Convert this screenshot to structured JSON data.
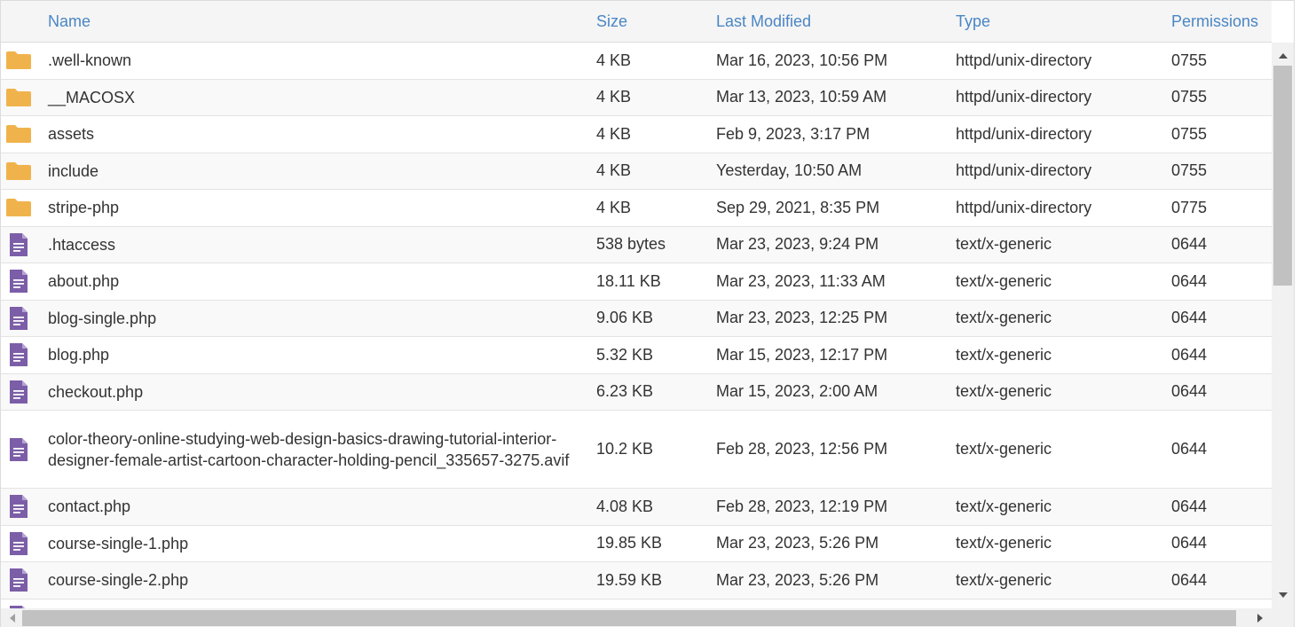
{
  "columns": {
    "name": "Name",
    "size": "Size",
    "modified": "Last Modified",
    "type": "Type",
    "permissions": "Permissions"
  },
  "colors": {
    "folder": "#f0b34c",
    "file": "#7b5ea7",
    "header_text": "#4a86c5"
  },
  "rows": [
    {
      "icon": "folder-icon",
      "name": ".well-known",
      "size": "4 KB",
      "modified": "Mar 16, 2023, 10:56 PM",
      "type": "httpd/unix-directory",
      "perm": "0755"
    },
    {
      "icon": "folder-icon",
      "name": "__MACOSX",
      "size": "4 KB",
      "modified": "Mar 13, 2023, 10:59 AM",
      "type": "httpd/unix-directory",
      "perm": "0755"
    },
    {
      "icon": "folder-icon",
      "name": "assets",
      "size": "4 KB",
      "modified": "Feb 9, 2023, 3:17 PM",
      "type": "httpd/unix-directory",
      "perm": "0755"
    },
    {
      "icon": "folder-icon",
      "name": "include",
      "size": "4 KB",
      "modified": "Yesterday, 10:50 AM",
      "type": "httpd/unix-directory",
      "perm": "0755"
    },
    {
      "icon": "folder-icon",
      "name": "stripe-php",
      "size": "4 KB",
      "modified": "Sep 29, 2021, 8:35 PM",
      "type": "httpd/unix-directory",
      "perm": "0775"
    },
    {
      "icon": "file-icon",
      "name": ".htaccess",
      "size": "538 bytes",
      "modified": "Mar 23, 2023, 9:24 PM",
      "type": "text/x-generic",
      "perm": "0644"
    },
    {
      "icon": "file-icon",
      "name": "about.php",
      "size": "18.11 KB",
      "modified": "Mar 23, 2023, 11:33 AM",
      "type": "text/x-generic",
      "perm": "0644"
    },
    {
      "icon": "file-icon",
      "name": "blog-single.php",
      "size": "9.06 KB",
      "modified": "Mar 23, 2023, 12:25 PM",
      "type": "text/x-generic",
      "perm": "0644"
    },
    {
      "icon": "file-icon",
      "name": "blog.php",
      "size": "5.32 KB",
      "modified": "Mar 15, 2023, 12:17 PM",
      "type": "text/x-generic",
      "perm": "0644"
    },
    {
      "icon": "file-icon",
      "name": "checkout.php",
      "size": "6.23 KB",
      "modified": "Mar 15, 2023, 2:00 AM",
      "type": "text/x-generic",
      "perm": "0644"
    },
    {
      "icon": "file-icon",
      "name": "color-theory-online-studying-web-design-basics-drawing-tutorial-interior-designer-female-artist-cartoon-character-holding-pencil_335657-3275.avif",
      "size": "10.2 KB",
      "modified": "Feb 28, 2023, 12:56 PM",
      "type": "text/x-generic",
      "perm": "0644",
      "tall": true
    },
    {
      "icon": "file-icon",
      "name": "contact.php",
      "size": "4.08 KB",
      "modified": "Feb 28, 2023, 12:19 PM",
      "type": "text/x-generic",
      "perm": "0644"
    },
    {
      "icon": "file-icon",
      "name": "course-single-1.php",
      "size": "19.85 KB",
      "modified": "Mar 23, 2023, 5:26 PM",
      "type": "text/x-generic",
      "perm": "0644"
    },
    {
      "icon": "file-icon",
      "name": "course-single-2.php",
      "size": "19.59 KB",
      "modified": "Mar 23, 2023, 5:26 PM",
      "type": "text/x-generic",
      "perm": "0644"
    },
    {
      "icon": "file-icon",
      "name": "",
      "size": "",
      "modified": "",
      "type": "",
      "perm": ""
    }
  ]
}
